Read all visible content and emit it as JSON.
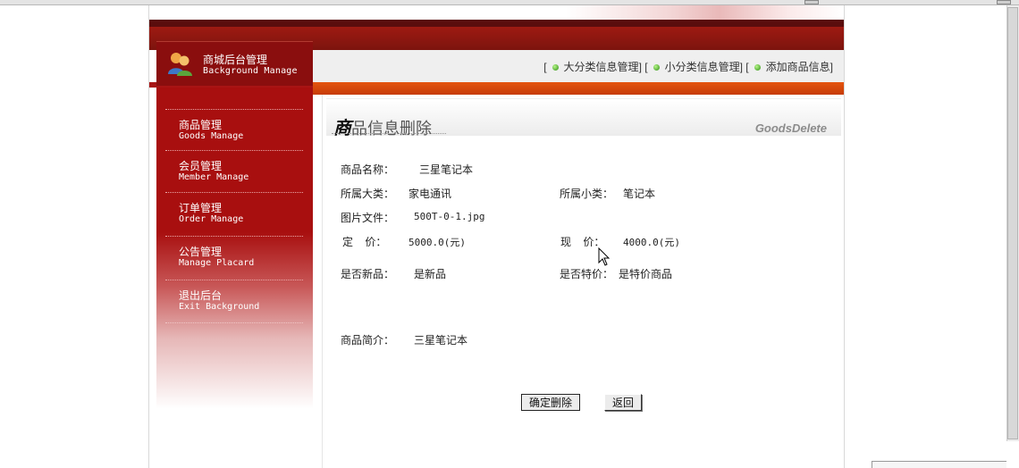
{
  "logo": {
    "title_cn": "商城后台管理",
    "title_en": "Background Manage",
    "icon": "users-icon"
  },
  "topnav": {
    "links": [
      "大分类信息管理",
      "小分类信息管理",
      "添加商品信息"
    ],
    "bracket_open": "[",
    "bracket_close": "]",
    "bullet_icon": "green-dot-icon"
  },
  "sidebar": {
    "items": [
      {
        "cn": "商品管理",
        "en": "Goods Manage"
      },
      {
        "cn": "会员管理",
        "en": "Member Manage"
      },
      {
        "cn": "订单管理",
        "en": "Order Manage"
      },
      {
        "cn": "公告管理",
        "en": "Manage Placard"
      },
      {
        "cn": "退出后台",
        "en": "Exit Background"
      }
    ]
  },
  "panel": {
    "title_first": "商",
    "title_rest": "品信息删除",
    "title_en": "GoodsDelete"
  },
  "form": {
    "name_label": "商品名称：",
    "name_value": "三星笔记本",
    "big_cat_label": "所属大类：",
    "big_cat_value": "家电通讯",
    "small_cat_label": "所属小类：",
    "small_cat_value": "笔记本",
    "image_label": "图片文件：",
    "image_value": "500T-0-1.jpg",
    "price_label": "定    价：",
    "price_value": "5000.0(元)",
    "now_price_label": "现    价：",
    "now_price_value": "4000.0(元)",
    "is_new_label": "是否新品：",
    "is_new_value": "是新品",
    "is_special_label": "是否特价：",
    "is_special_value": "是特价商品",
    "intro_label": "商品简介：",
    "intro_value": "三星笔记本"
  },
  "buttons": {
    "confirm": "确定删除",
    "back": "返回"
  },
  "colors": {
    "sidebar_red": "#a80f0f",
    "header_dark": "#5a0d0d",
    "orange": "#e4540f",
    "nav_bg": "#efefef"
  }
}
